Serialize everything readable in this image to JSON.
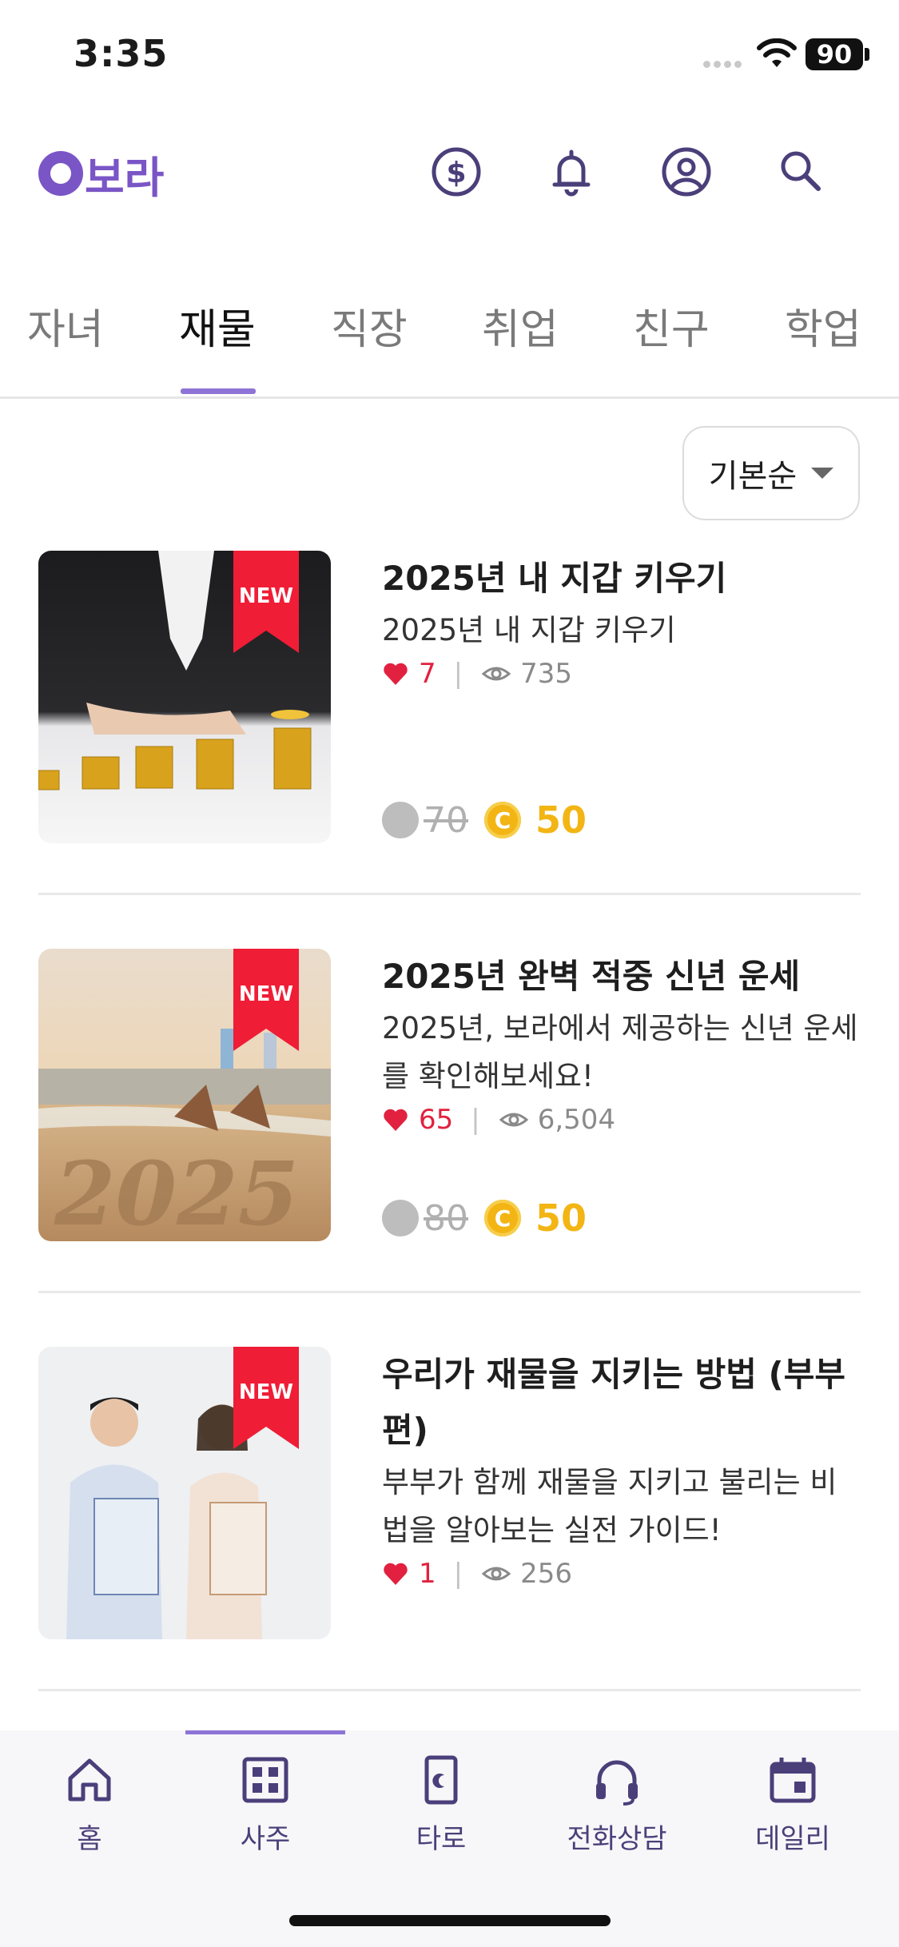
{
  "status_bar": {
    "time": "3:35",
    "battery": "90"
  },
  "header": {
    "logo_text": "보라",
    "icons": [
      "coin-dollar-icon",
      "bell-icon",
      "profile-icon",
      "search-icon"
    ]
  },
  "tabs": [
    "자녀",
    "재물",
    "직장",
    "취업",
    "친구",
    "학업"
  ],
  "active_tab": "재물",
  "sort": {
    "label": "기본순"
  },
  "items": [
    {
      "badge": "NEW",
      "title": "2025년 내 지갑 키우기",
      "description": "2025년 내 지갑 키우기",
      "likes": "7",
      "views": "735",
      "old_price": "70",
      "price": "50"
    },
    {
      "badge": "NEW",
      "title": "2025년 완벽 적중 신년 운세",
      "description": "2025년, 보라에서 제공하는 신년 운세를 확인해보세요!",
      "likes": "65",
      "views": "6,504",
      "old_price": "80",
      "price": "50"
    },
    {
      "badge": "NEW",
      "title": "우리가 재물을 지키는 방법 (부부편)",
      "description": "부부가 함께 재물을 지키고 불리는 비법을 알아보는 실전 가이드!",
      "likes": "1",
      "views": "256"
    }
  ],
  "coin_letter": "C",
  "bottom_nav": [
    {
      "label": "홈",
      "icon": "home-icon"
    },
    {
      "label": "사주",
      "icon": "grid-icon"
    },
    {
      "label": "타로",
      "icon": "tarot-card-icon"
    },
    {
      "label": "전화상담",
      "icon": "headset-icon"
    },
    {
      "label": "데일리",
      "icon": "calendar-icon"
    }
  ],
  "bottom_nav_active": "사주",
  "colors": {
    "accent": "#7a55c6",
    "like": "#e1213f",
    "coin": "#f2b514",
    "ribbon": "#ef1d36"
  }
}
